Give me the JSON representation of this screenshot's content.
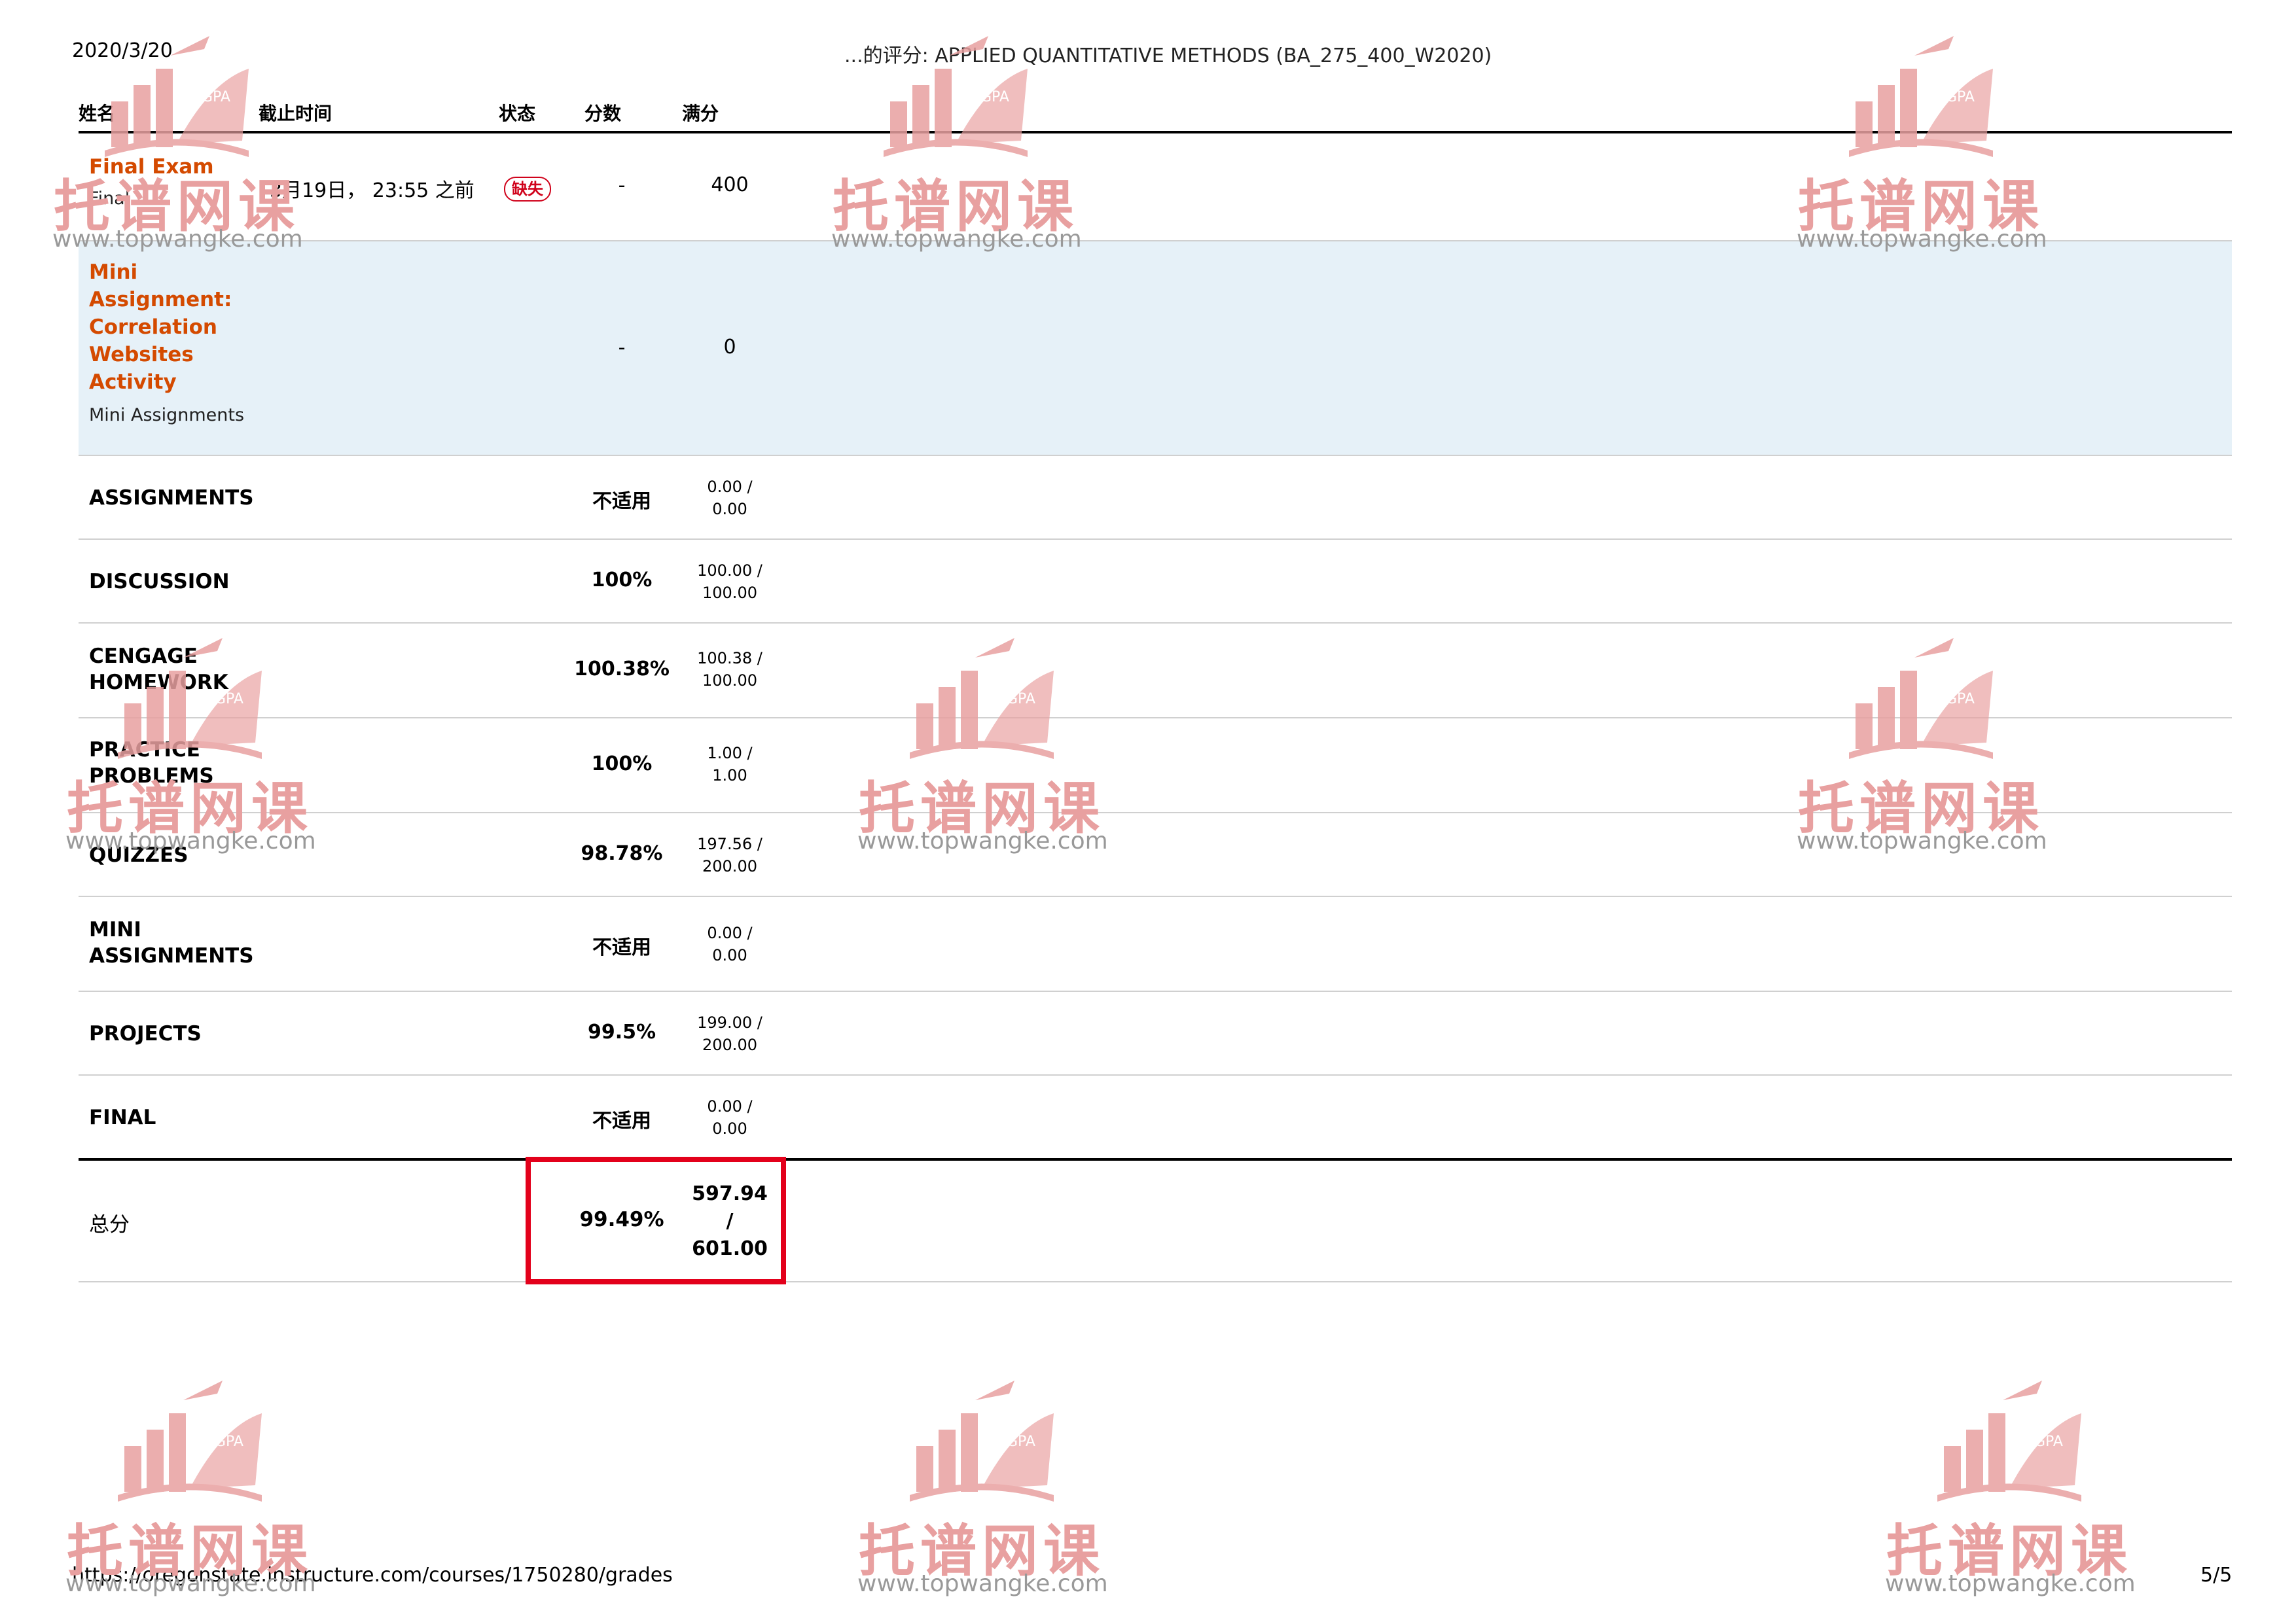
{
  "header": {
    "date": "2020/3/20",
    "title": "...的评分: APPLIED QUANTITATIVE METHODS (BA_275_400_W2020)"
  },
  "columns": {
    "name": "姓名",
    "due": "截止时间",
    "status": "状态",
    "score": "分数",
    "max": "满分"
  },
  "items": [
    {
      "title": "Final Exam",
      "group": "Final",
      "due": "3月19日， 23:55 之前",
      "status": "缺失",
      "score": "-",
      "max": "400"
    },
    {
      "title_lines": [
        "Mini",
        "Assignment:",
        "Correlation",
        "Websites",
        "Activity"
      ],
      "group": "Mini Assignments",
      "score": "-",
      "max": "0"
    }
  ],
  "groups": [
    {
      "name_lines": [
        "ASSIGNMENTS"
      ],
      "score": "不适用",
      "max_lines": [
        "0.00 /",
        "0.00"
      ]
    },
    {
      "name_lines": [
        "DISCUSSION"
      ],
      "score": "100%",
      "max_lines": [
        "100.00 /",
        "100.00"
      ]
    },
    {
      "name_lines": [
        "CENGAGE",
        "HOMEWORK"
      ],
      "score": "100.38%",
      "max_lines": [
        "100.38 /",
        "100.00"
      ]
    },
    {
      "name_lines": [
        "PRACTICE",
        "PROBLEMS"
      ],
      "score": "100%",
      "max_lines": [
        "1.00 /",
        "1.00"
      ]
    },
    {
      "name_lines": [
        "QUIZZES"
      ],
      "score": "98.78%",
      "max_lines": [
        "197.56 /",
        "200.00"
      ]
    },
    {
      "name_lines": [
        "MINI",
        "ASSIGNMENTS"
      ],
      "score": "不适用",
      "max_lines": [
        "0.00 /",
        "0.00"
      ]
    },
    {
      "name_lines": [
        "PROJECTS"
      ],
      "score": "99.5%",
      "max_lines": [
        "199.00 /",
        "200.00"
      ]
    },
    {
      "name_lines": [
        "FINAL"
      ],
      "score": "不适用",
      "max_lines": [
        "0.00 /",
        "0.00"
      ]
    }
  ],
  "total": {
    "label": "总分",
    "score": "99.49%",
    "max_lines": [
      "597.94",
      "/",
      "601.00"
    ]
  },
  "footer": {
    "url": "https://oregonstate.instructure.com/courses/1750280/grades",
    "page": "5/5"
  },
  "watermark": {
    "text": "托谱网课",
    "url": "www.topwangke.com",
    "badge": "GPA"
  },
  "colors": {
    "link": "#d44a00",
    "highlight_row": "#e6f1f8",
    "red_box": "#e3001b",
    "watermark": "#e8a0a0"
  }
}
